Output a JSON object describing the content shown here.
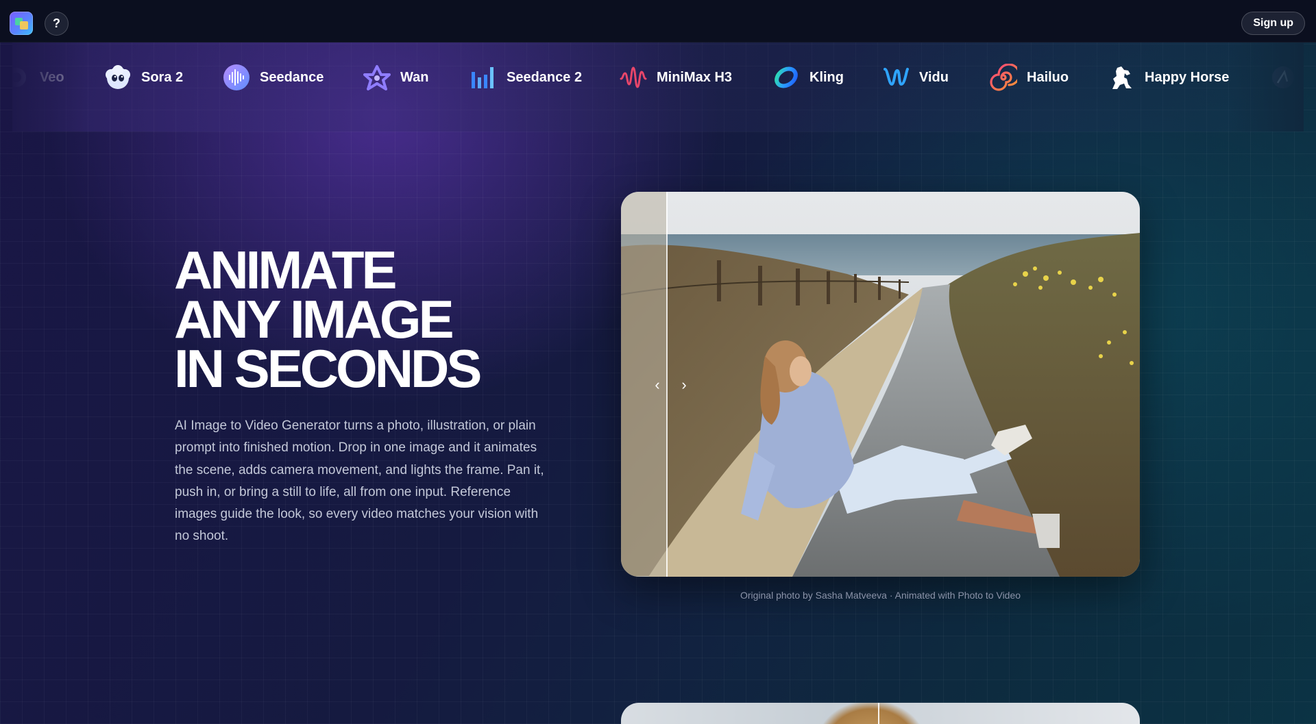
{
  "header": {
    "help_label": "?",
    "signup_label": "Sign up"
  },
  "models": [
    {
      "name": "Veo",
      "icon": "veo-icon"
    },
    {
      "name": "Sora 2",
      "icon": "sora-cloud-icon"
    },
    {
      "name": "Seedance",
      "icon": "seedance-wave-icon"
    },
    {
      "name": "Wan",
      "icon": "wan-star-icon"
    },
    {
      "name": "Seedance 2",
      "icon": "seedance2-bars-icon"
    },
    {
      "name": "MiniMax H3",
      "icon": "minimax-wave-icon"
    },
    {
      "name": "Kling",
      "icon": "kling-ring-icon"
    },
    {
      "name": "Vidu",
      "icon": "vidu-v-icon"
    },
    {
      "name": "Hailuo",
      "icon": "hailuo-spiral-icon"
    },
    {
      "name": "Happy Horse",
      "icon": "horse-icon"
    }
  ],
  "hero": {
    "title_line1": "ANIMATE",
    "title_line2": "ANY IMAGE",
    "title_line3": "IN SECONDS",
    "description": "AI Image to Video Generator turns a photo, illustration, or plain prompt into finished motion. Drop in one image and it animates the scene, adds camera movement, and lights the frame. Pan it, push in, or bring a still to life, all from one input. Reference images guide the look, so every video matches your vision with no shoot."
  },
  "comparison": {
    "prev_arrow": "‹",
    "next_arrow": "›",
    "caption": "Original photo by Sasha Matveeva · Animated with Photo to Video"
  }
}
